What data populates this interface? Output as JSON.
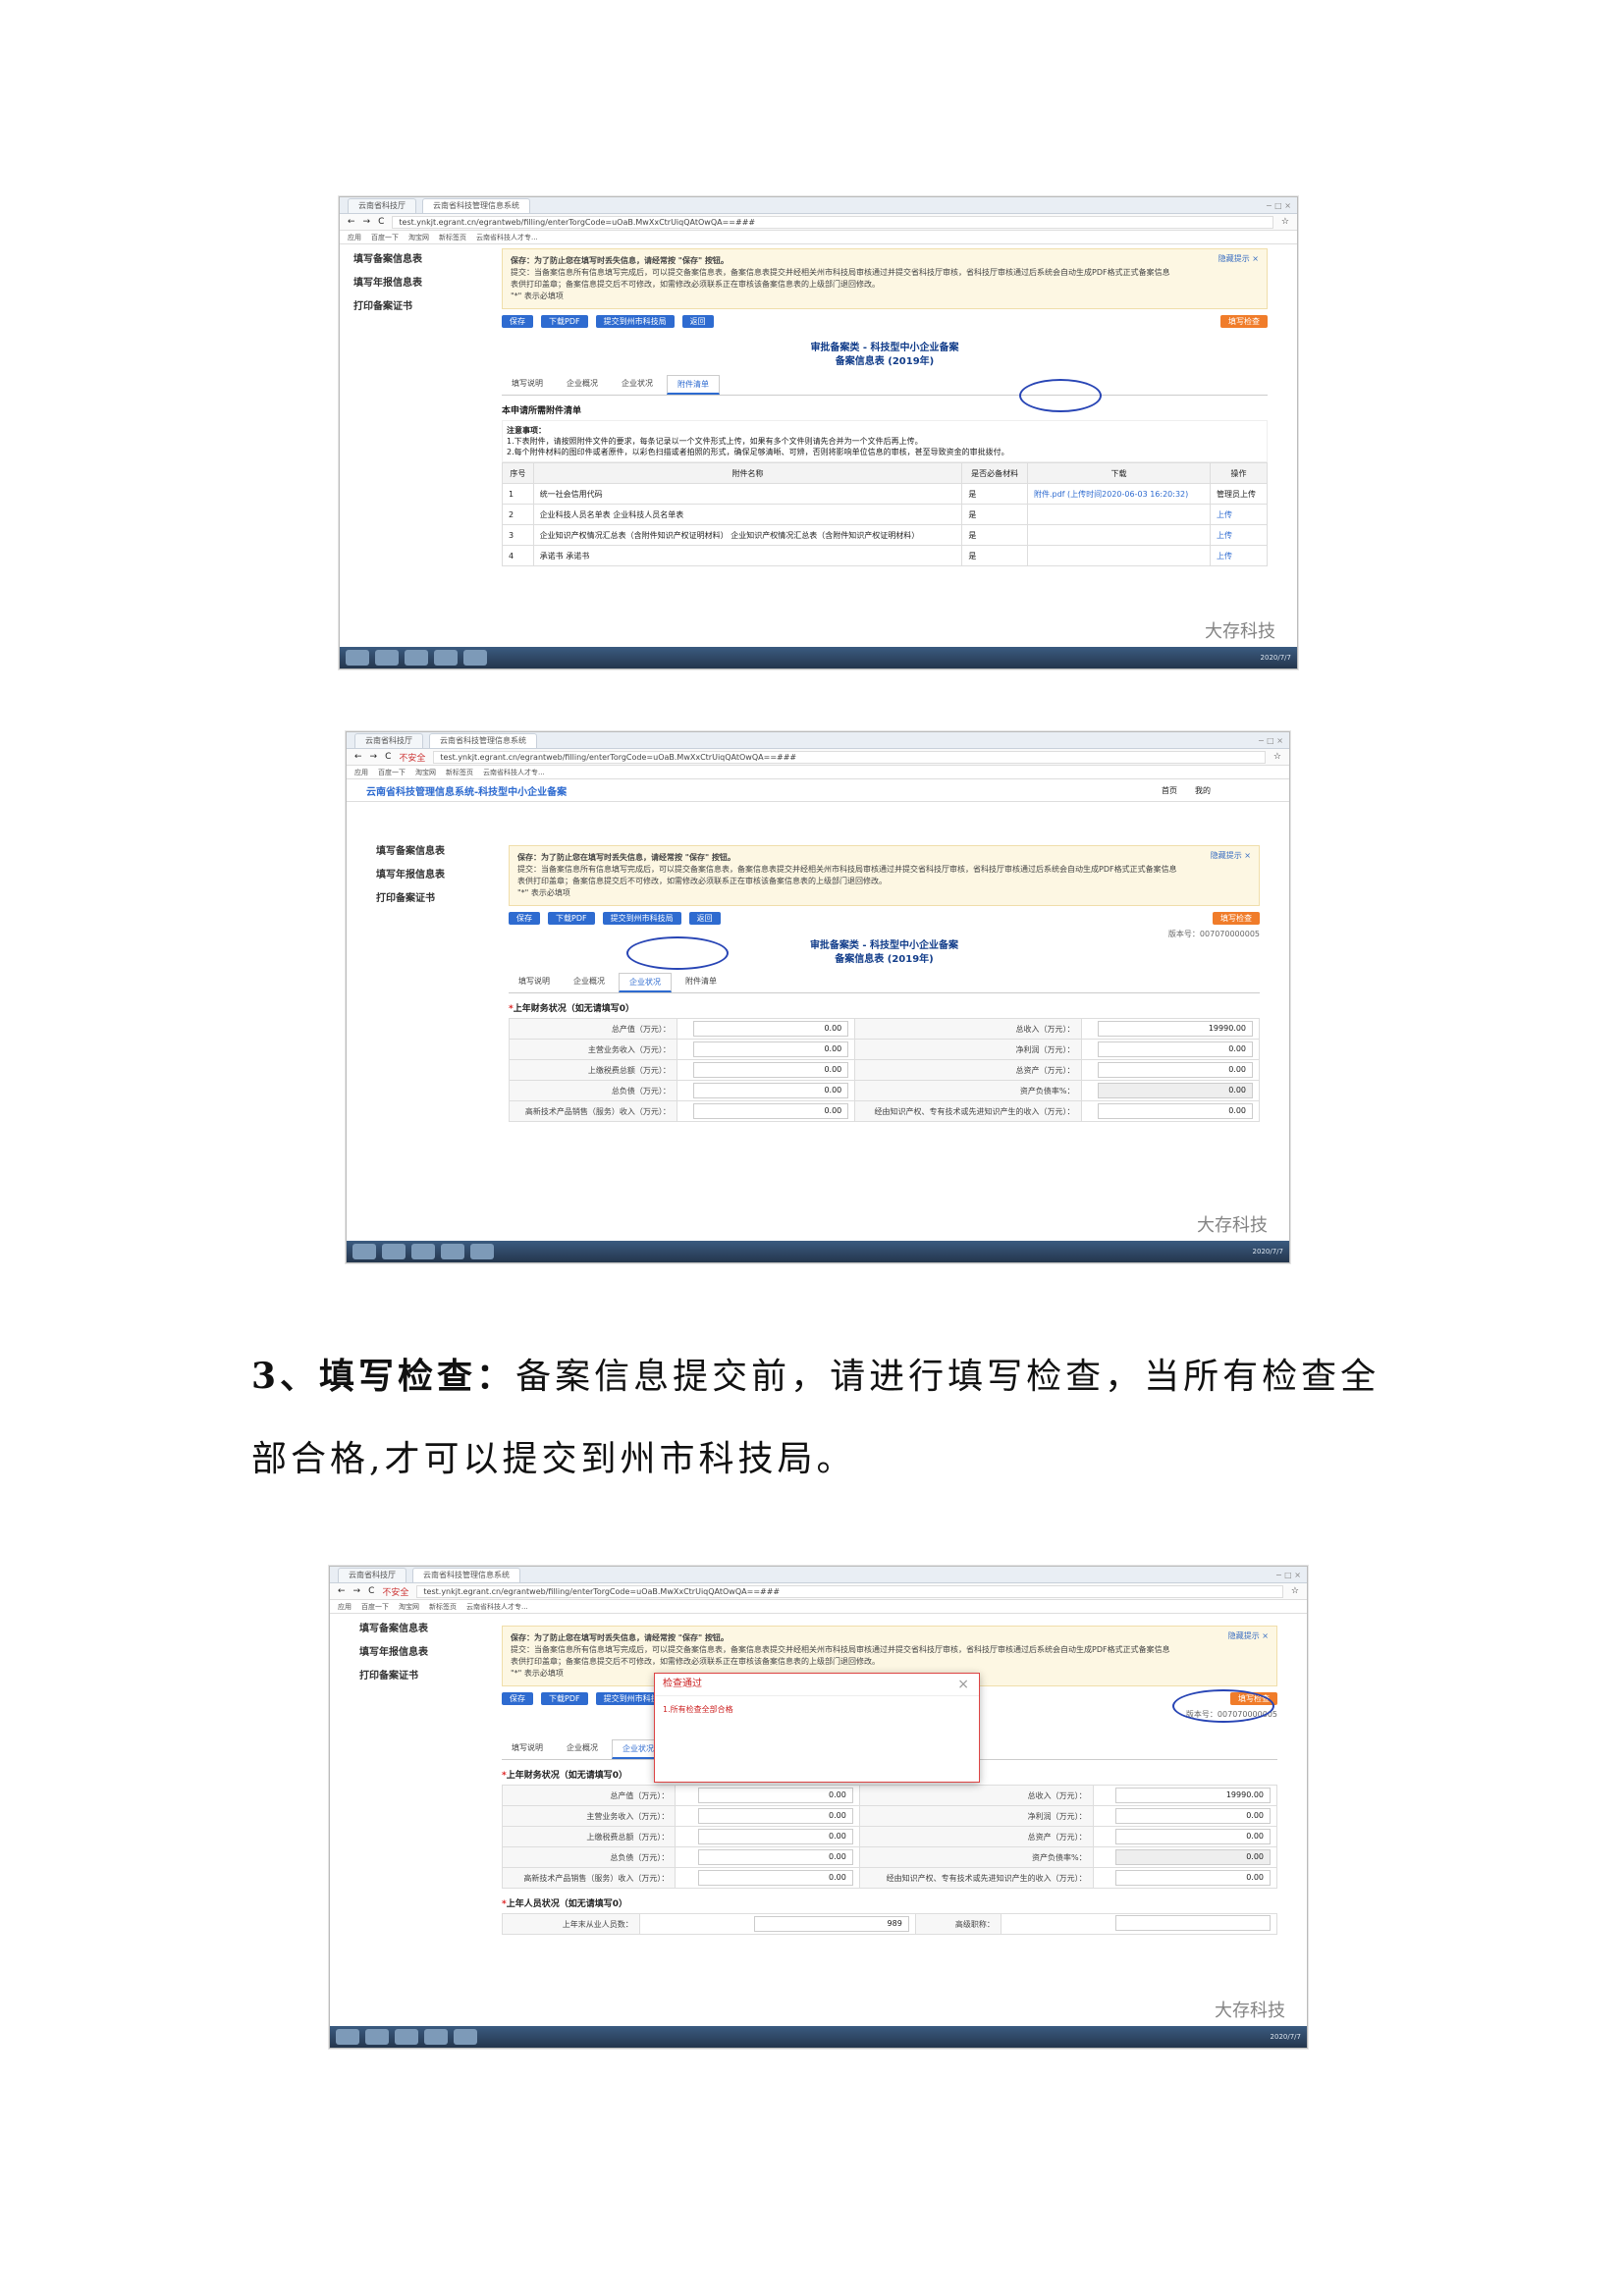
{
  "browser": {
    "tab1": "云南省科技厅",
    "tab2": "云南省科技管理信息系统",
    "url": "test.ynkjt.egrant.cn/egrantweb/filling/enterTorgCode=uOaB.MwXxCtrUiqQAtOwQA==###",
    "insecure": "不安全",
    "bookmarks": [
      "应用",
      "百度一下",
      "淘宝网",
      "新标签页",
      "云南省科技人才专..."
    ],
    "winctl": "− □ ×"
  },
  "sidebar": [
    "填写备案信息表",
    "填写年报信息表",
    "打印备案证书"
  ],
  "site_title": "云南省科技管理信息系统-科技型中小企业备案",
  "nav": [
    "首页",
    "我的"
  ],
  "notice": {
    "hide": "隐藏提示 ×",
    "line1": "保存：为了防止您在填写时丢失信息，请经常按 \"保存\" 按钮。",
    "line2": "提交：当备案信息所有信息填写完成后，可以提交备案信息表，备案信息表提交并经相关州市科技局审核通过并提交省科技厅审核，省科技厅审核通过后系统会自动生成PDF格式正式备案信息",
    "line3": "表供打印盖章；备案信息提交后不可修改，如需修改必须联系正在审核该备案信息表的上级部门退回修改。",
    "line4": "\"*\" 表示必填项"
  },
  "buttons": {
    "save": "保存",
    "pdf": "下载PDF",
    "submit": "提交到州市科技局",
    "back": "返回",
    "check": "填写检查"
  },
  "form_no": "版本号：007070000005",
  "form_title1": "审批备案类 - 科技型中小企业备案",
  "form_title2": "备案信息表 (2019年)",
  "form_tabs": [
    "填写说明",
    "企业概况",
    "企业状况",
    "附件清单"
  ],
  "attachments": {
    "heading": "本申请所需附件清单",
    "note_title": "注意事项：",
    "note1": "1.下表附件，请按照附件文件的要求，每条记录以一个文件形式上传，如果有多个文件则请先合并为一个文件后再上传。",
    "note2": "2.每个附件材料的图印件或者原件，以彩色扫描或者拍照的形式，确保足够清晰、可辨，否则将影响单位信息的审核，甚至导致资金的审批拨付。",
    "headers": [
      "序号",
      "附件名称",
      "是否必备材料",
      "下载",
      "操作"
    ],
    "rows": [
      {
        "no": "1",
        "name": "统一社会信用代码",
        "req": "是",
        "dl": "附件.pdf (上传时间2020-06-03 16:20:32)",
        "op": "管理员上传"
      },
      {
        "no": "2",
        "name": "企业科技人员名单表  企业科技人员名单表",
        "req": "是",
        "dl": "",
        "op": "上传"
      },
      {
        "no": "3",
        "name": "企业知识产权情况汇总表（含附件知识产权证明材料） 企业知识产权情况汇总表（含附件知识产权证明材料）",
        "req": "是",
        "dl": "",
        "op": "上传"
      },
      {
        "no": "4",
        "name": "承诺书  承诺书",
        "req": "是",
        "dl": "",
        "op": "上传"
      }
    ]
  },
  "finance": {
    "heading": "上年财务状况（如无请填写0）",
    "rows": [
      {
        "l1": "总产值（万元）：",
        "v1": "0.00",
        "l2": "总收入（万元）：",
        "v2": "19990.00"
      },
      {
        "l1": "主营业务收入（万元）：",
        "v1": "0.00",
        "l2": "净利润（万元）：",
        "v2": "0.00"
      },
      {
        "l1": "上缴税费总额（万元）：",
        "v1": "0.00",
        "l2": "总资产（万元）：",
        "v2": "0.00"
      },
      {
        "l1": "总负债（万元）：",
        "v1": "0.00",
        "l2": "资产负债率%：",
        "v2": "0.00"
      },
      {
        "l1": "高新技术产品销售（服务）收入（万元）：",
        "v1": "0.00",
        "l2": "经由知识产权、专有技术或先进知识产生的收入（万元）：",
        "v2": "0.00"
      }
    ]
  },
  "staff": {
    "heading": "上年人员状况（如无请填写0）",
    "l1": "上年末从业人员数：",
    "v1": "989",
    "l2": "高级职称："
  },
  "dialog": {
    "title": "检查通过",
    "msg": "1.所有检查全部合格"
  },
  "watermark": "大存科技",
  "tray": "2020/7/7",
  "paragraph": {
    "bold": "3、填写检查：",
    "text": "备案信息提交前，请进行填写检查，当所有检查全部合格,才可以提交到州市科技局。"
  }
}
